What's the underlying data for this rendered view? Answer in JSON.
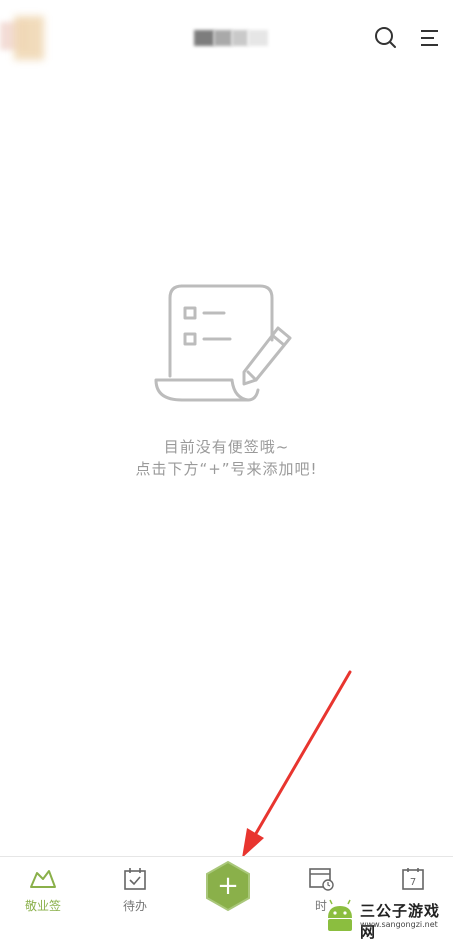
{
  "top_bar": {
    "avatar_icon": "user-avatar-blurred",
    "title_blurred": true,
    "search_icon": "search-icon",
    "menu_icon": "menu-icon"
  },
  "empty_state": {
    "icon": "empty-notes-icon",
    "line1": "目前没有便签哦~",
    "line2": "点击下方“+”号来添加吧!"
  },
  "tabs": [
    {
      "label": "敬业签",
      "icon": "logo-icon",
      "active": true
    },
    {
      "label": "待办",
      "icon": "todo-check-icon",
      "active": false
    },
    {
      "label": "时",
      "icon": "time-icon",
      "active": false
    },
    {
      "label": "",
      "icon": "calendar-icon",
      "active": false,
      "badge": "7"
    }
  ],
  "add_button": {
    "label": "+",
    "color": "#8ab04a"
  },
  "annotation": {
    "type": "red-arrow",
    "color": "#e8352f"
  },
  "watermark": {
    "title": "三公子游戏网",
    "url": "www.sangongzi.net"
  },
  "colors": {
    "accent": "#8ab04a",
    "icon_gray": "#bcbcbc",
    "text_gray": "#9a9a9a"
  }
}
